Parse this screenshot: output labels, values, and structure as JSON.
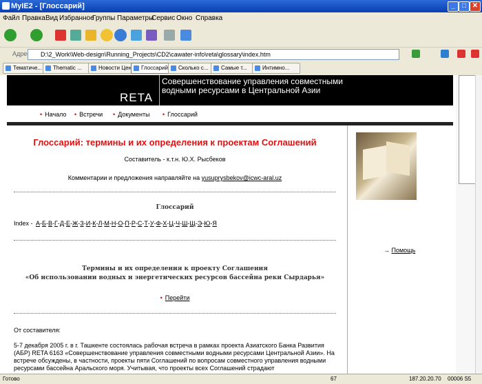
{
  "window": {
    "title": "MyIE2 - [Глоссарий]"
  },
  "menu": [
    "Файл",
    "Правка",
    "Вид",
    "Избранное",
    "Группы",
    "Параметры",
    "Сервис",
    "Окно",
    "Справка"
  ],
  "address": {
    "label": "Адрес",
    "value": "D:\\2_Work\\Web-design\\Running_Projects\\CD2\\cawater-info\\reta\\glossary\\index.htm"
  },
  "tabs": [
    "Тематиче...",
    "Thematic ...",
    "Новости Цен...",
    "Глоссарий",
    "Сколько с...",
    "Самые т...",
    "Интимно..."
  ],
  "header": {
    "logo": "RETA",
    "subtitle": "Совершенствование управления совместными водными ресурсами в Центральной Азии"
  },
  "nav": [
    "Начало",
    "Встречи",
    "Документы",
    "Глоссарий"
  ],
  "main": {
    "title": "Глоссарий: термины и их определения к проектам Соглашений",
    "author": "Составитель - к.т.н. Ю.Х. Рысбеков",
    "comments_text": "Комментарии и предложения направляйте на ",
    "comments_email": "yusuprysbekov@icwc-aral.uz",
    "glossary_heading": "Глоссарий",
    "index_label": "Index -",
    "letters": [
      "А",
      "Б",
      "В",
      "Г",
      "Д",
      "Е",
      "Ж",
      "З",
      "И",
      "К",
      "Л",
      "М",
      "Н",
      "О",
      "П",
      "Р",
      "С",
      "Т",
      "У",
      "Ф",
      "Х",
      "Ц",
      "Ч",
      "Ш",
      "Щ",
      "Э",
      "Ю",
      "Я"
    ],
    "terms_line1": "Термины и их определения к проекту Соглашения",
    "terms_line2": "«Об использовании водных и энергетических ресурсов бассейна реки Сырдарья»",
    "goto_label": "Перейти",
    "from_author": "От составителя:",
    "paragraph": "5-7 декабря 2005 г. в г. Ташкенте состоялась рабочая встреча в рамках проекта Азиатского Банка Развития (АБР) RETA 6163 «Совершенствование управления совместными водными ресурсами Центральной Азии». На встрече обсуждены, в частности, проекты пяти Соглашений по вопросам совместного управления водными ресурсами бассейна Аральского моря. Учитывая, что проекты всех Соглашений страдают"
  },
  "sidebar": {
    "help_label": "Помощь"
  },
  "status": {
    "text": "Готово",
    "zoom": "67",
    "ip": "187.20.20.70",
    "time": "00006 S5"
  }
}
